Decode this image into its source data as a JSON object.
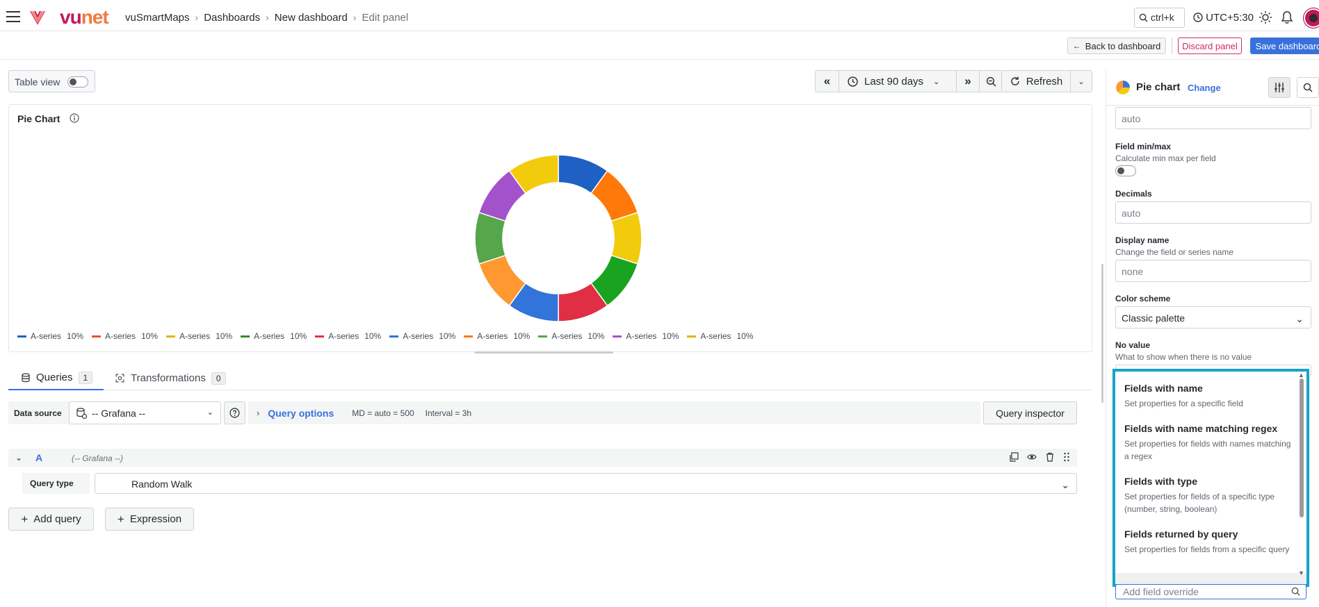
{
  "header": {
    "logo_text_vu": "vu",
    "logo_text_net": "net",
    "breadcrumbs": [
      "vuSmartMaps",
      "Dashboards",
      "New dashboard",
      "Edit panel"
    ],
    "search_label": "ctrl+k",
    "timezone": "UTC+5:30"
  },
  "toolbar": {
    "back_label": "Back to dashboard",
    "discard_label": "Discard panel",
    "save_label": "Save dashboard"
  },
  "editor": {
    "table_view_label": "Table view",
    "time_range": "Last 90 days",
    "refresh_label": "Refresh"
  },
  "panel": {
    "title": "Pie Chart",
    "legend": [
      {
        "name": "A-series",
        "pct": "10%"
      },
      {
        "name": "A-series",
        "pct": "10%"
      },
      {
        "name": "A-series",
        "pct": "10%"
      },
      {
        "name": "A-series",
        "pct": "10%"
      },
      {
        "name": "A-series",
        "pct": "10%"
      },
      {
        "name": "A-series",
        "pct": "10%"
      },
      {
        "name": "A-series",
        "pct": "10%"
      },
      {
        "name": "A-series",
        "pct": "10%"
      },
      {
        "name": "A-series",
        "pct": "10%"
      },
      {
        "name": "A-series",
        "pct": "10%"
      }
    ]
  },
  "chart_data": {
    "type": "pie",
    "variant": "donut",
    "title": "Pie Chart",
    "categories": [
      "A-series",
      "A-series",
      "A-series",
      "A-series",
      "A-series",
      "A-series",
      "A-series",
      "A-series",
      "A-series",
      "A-series"
    ],
    "values": [
      10,
      10,
      10,
      10,
      10,
      10,
      10,
      10,
      10,
      10
    ],
    "colors": [
      "#1f60c4",
      "#e0561b",
      "#e0b400",
      "#37872d",
      "#e02f44",
      "#3274d9",
      "#ff780a",
      "#56a64b",
      "#a352cc",
      "#e0b400"
    ],
    "slice_colors_clockwise_from_top": [
      "#1f60c4",
      "#ff780a",
      "#f2cc0c",
      "#19a31e",
      "#e02f44",
      "#3274d9",
      "#ff9830",
      "#56a64b",
      "#a352cc",
      "#f2cc0c"
    ],
    "legend_placement": "bottom"
  },
  "tabs": {
    "queries_label": "Queries",
    "queries_count": "1",
    "transformations_label": "Transformations",
    "transformations_count": "0"
  },
  "query": {
    "data_source_label": "Data source",
    "data_source_value": "-- Grafana --",
    "options_label": "Query options",
    "md_text": "MD = auto = 500",
    "interval_text": "Interval = 3h",
    "inspector_label": "Query inspector",
    "ref_id": "A",
    "ref_ds": "(-- Grafana --)",
    "query_type_label": "Query type",
    "query_type_value": "Random Walk",
    "add_query_label": "Add query",
    "expression_label": "Expression"
  },
  "options": {
    "viz_name": "Pie chart",
    "change_label": "Change",
    "first_input": "auto",
    "field_minmax_label": "Field min/max",
    "field_minmax_desc": "Calculate min max per field",
    "decimals_label": "Decimals",
    "decimals_value": "auto",
    "display_name_label": "Display name",
    "display_name_desc": "Change the field or series name",
    "display_name_value": "none",
    "color_scheme_label": "Color scheme",
    "color_scheme_value": "Classic palette",
    "no_value_label": "No value",
    "no_value_desc": "What to show when there is no value"
  },
  "override_popup": {
    "items": [
      {
        "title": "Fields with name",
        "desc": "Set properties for a specific field"
      },
      {
        "title": "Fields with name matching regex",
        "desc": "Set properties for fields with names matching a regex"
      },
      {
        "title": "Fields with type",
        "desc": "Set properties for fields of a specific type (number, string, boolean)"
      },
      {
        "title": "Fields returned by query",
        "desc": "Set properties for fields from a specific query"
      }
    ],
    "search_placeholder": "Add field override"
  }
}
